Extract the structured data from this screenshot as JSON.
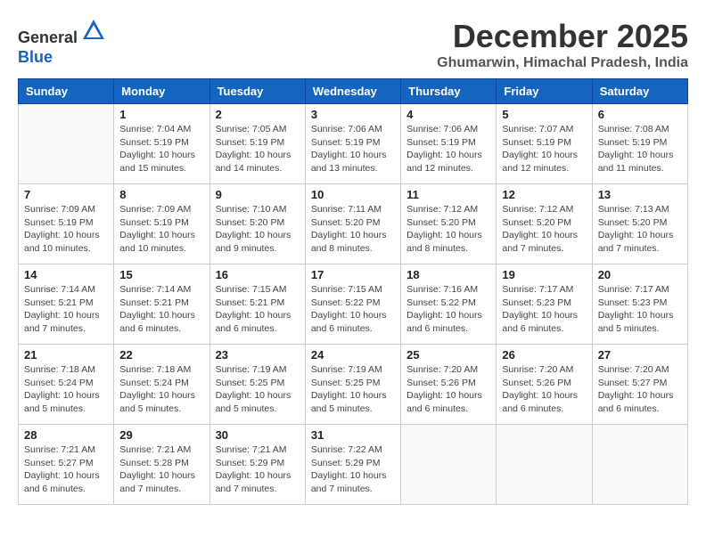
{
  "header": {
    "logo_general": "General",
    "logo_blue": "Blue",
    "month_title": "December 2025",
    "location": "Ghumarwin, Himachal Pradesh, India"
  },
  "days_of_week": [
    "Sunday",
    "Monday",
    "Tuesday",
    "Wednesday",
    "Thursday",
    "Friday",
    "Saturday"
  ],
  "weeks": [
    [
      {
        "day": "",
        "info": ""
      },
      {
        "day": "1",
        "info": "Sunrise: 7:04 AM\nSunset: 5:19 PM\nDaylight: 10 hours\nand 15 minutes."
      },
      {
        "day": "2",
        "info": "Sunrise: 7:05 AM\nSunset: 5:19 PM\nDaylight: 10 hours\nand 14 minutes."
      },
      {
        "day": "3",
        "info": "Sunrise: 7:06 AM\nSunset: 5:19 PM\nDaylight: 10 hours\nand 13 minutes."
      },
      {
        "day": "4",
        "info": "Sunrise: 7:06 AM\nSunset: 5:19 PM\nDaylight: 10 hours\nand 12 minutes."
      },
      {
        "day": "5",
        "info": "Sunrise: 7:07 AM\nSunset: 5:19 PM\nDaylight: 10 hours\nand 12 minutes."
      },
      {
        "day": "6",
        "info": "Sunrise: 7:08 AM\nSunset: 5:19 PM\nDaylight: 10 hours\nand 11 minutes."
      }
    ],
    [
      {
        "day": "7",
        "info": "Sunrise: 7:09 AM\nSunset: 5:19 PM\nDaylight: 10 hours\nand 10 minutes."
      },
      {
        "day": "8",
        "info": "Sunrise: 7:09 AM\nSunset: 5:19 PM\nDaylight: 10 hours\nand 10 minutes."
      },
      {
        "day": "9",
        "info": "Sunrise: 7:10 AM\nSunset: 5:20 PM\nDaylight: 10 hours\nand 9 minutes."
      },
      {
        "day": "10",
        "info": "Sunrise: 7:11 AM\nSunset: 5:20 PM\nDaylight: 10 hours\nand 8 minutes."
      },
      {
        "day": "11",
        "info": "Sunrise: 7:12 AM\nSunset: 5:20 PM\nDaylight: 10 hours\nand 8 minutes."
      },
      {
        "day": "12",
        "info": "Sunrise: 7:12 AM\nSunset: 5:20 PM\nDaylight: 10 hours\nand 7 minutes."
      },
      {
        "day": "13",
        "info": "Sunrise: 7:13 AM\nSunset: 5:20 PM\nDaylight: 10 hours\nand 7 minutes."
      }
    ],
    [
      {
        "day": "14",
        "info": "Sunrise: 7:14 AM\nSunset: 5:21 PM\nDaylight: 10 hours\nand 7 minutes."
      },
      {
        "day": "15",
        "info": "Sunrise: 7:14 AM\nSunset: 5:21 PM\nDaylight: 10 hours\nand 6 minutes."
      },
      {
        "day": "16",
        "info": "Sunrise: 7:15 AM\nSunset: 5:21 PM\nDaylight: 10 hours\nand 6 minutes."
      },
      {
        "day": "17",
        "info": "Sunrise: 7:15 AM\nSunset: 5:22 PM\nDaylight: 10 hours\nand 6 minutes."
      },
      {
        "day": "18",
        "info": "Sunrise: 7:16 AM\nSunset: 5:22 PM\nDaylight: 10 hours\nand 6 minutes."
      },
      {
        "day": "19",
        "info": "Sunrise: 7:17 AM\nSunset: 5:23 PM\nDaylight: 10 hours\nand 6 minutes."
      },
      {
        "day": "20",
        "info": "Sunrise: 7:17 AM\nSunset: 5:23 PM\nDaylight: 10 hours\nand 5 minutes."
      }
    ],
    [
      {
        "day": "21",
        "info": "Sunrise: 7:18 AM\nSunset: 5:24 PM\nDaylight: 10 hours\nand 5 minutes."
      },
      {
        "day": "22",
        "info": "Sunrise: 7:18 AM\nSunset: 5:24 PM\nDaylight: 10 hours\nand 5 minutes."
      },
      {
        "day": "23",
        "info": "Sunrise: 7:19 AM\nSunset: 5:25 PM\nDaylight: 10 hours\nand 5 minutes."
      },
      {
        "day": "24",
        "info": "Sunrise: 7:19 AM\nSunset: 5:25 PM\nDaylight: 10 hours\nand 5 minutes."
      },
      {
        "day": "25",
        "info": "Sunrise: 7:20 AM\nSunset: 5:26 PM\nDaylight: 10 hours\nand 6 minutes."
      },
      {
        "day": "26",
        "info": "Sunrise: 7:20 AM\nSunset: 5:26 PM\nDaylight: 10 hours\nand 6 minutes."
      },
      {
        "day": "27",
        "info": "Sunrise: 7:20 AM\nSunset: 5:27 PM\nDaylight: 10 hours\nand 6 minutes."
      }
    ],
    [
      {
        "day": "28",
        "info": "Sunrise: 7:21 AM\nSunset: 5:27 PM\nDaylight: 10 hours\nand 6 minutes."
      },
      {
        "day": "29",
        "info": "Sunrise: 7:21 AM\nSunset: 5:28 PM\nDaylight: 10 hours\nand 7 minutes."
      },
      {
        "day": "30",
        "info": "Sunrise: 7:21 AM\nSunset: 5:29 PM\nDaylight: 10 hours\nand 7 minutes."
      },
      {
        "day": "31",
        "info": "Sunrise: 7:22 AM\nSunset: 5:29 PM\nDaylight: 10 hours\nand 7 minutes."
      },
      {
        "day": "",
        "info": ""
      },
      {
        "day": "",
        "info": ""
      },
      {
        "day": "",
        "info": ""
      }
    ]
  ]
}
